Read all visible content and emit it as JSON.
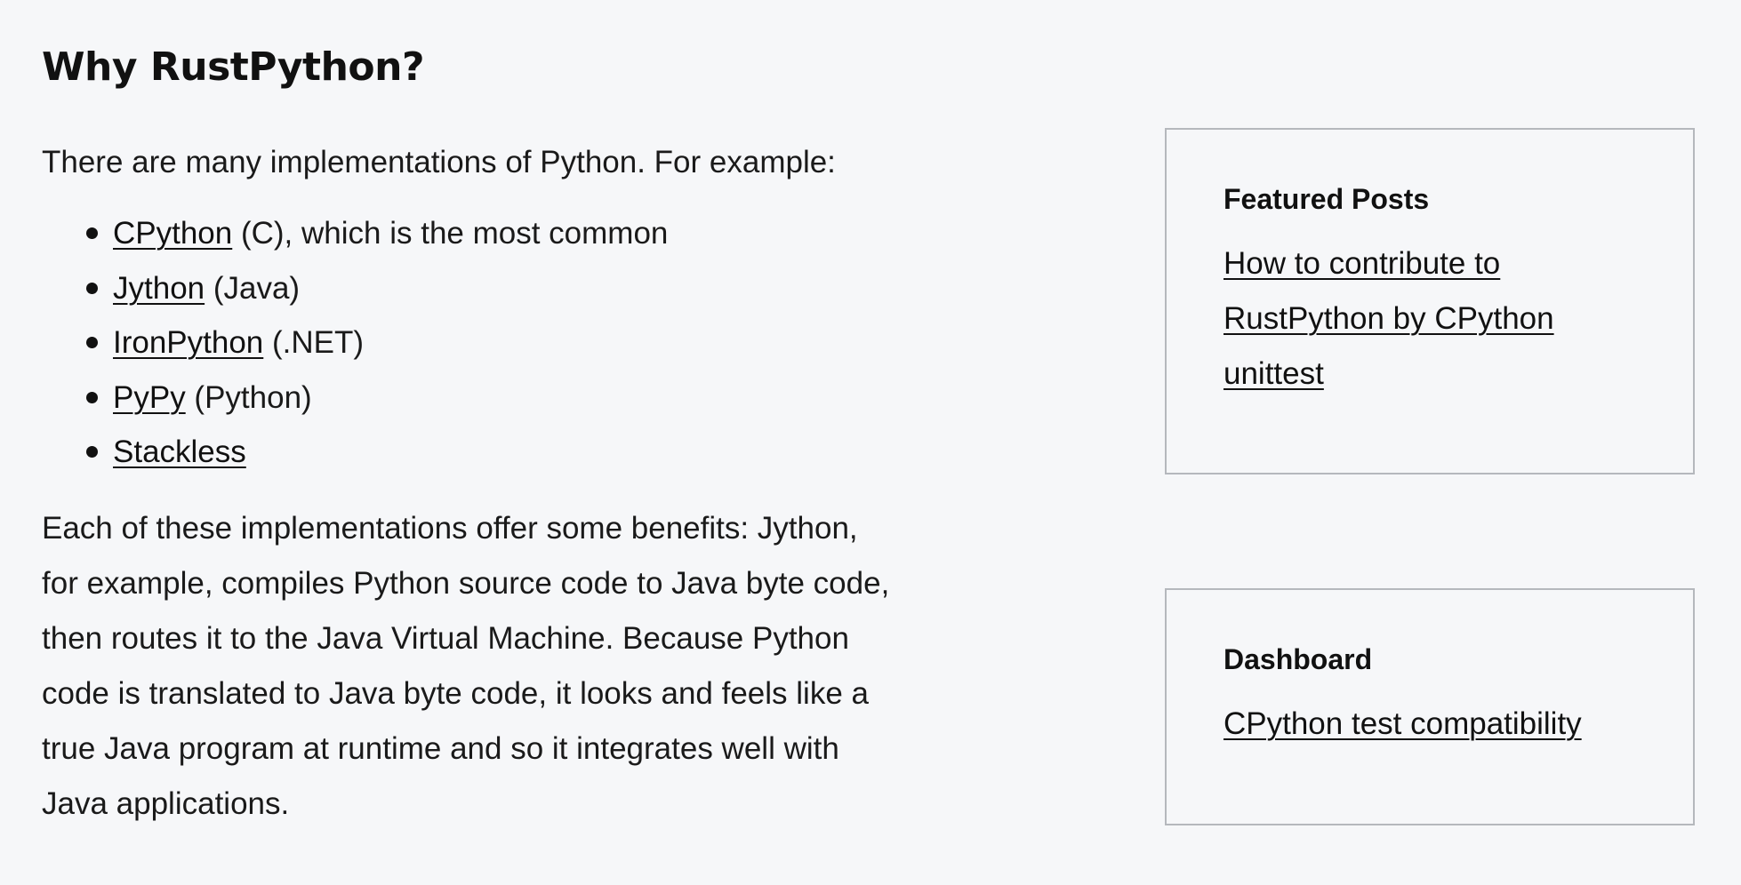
{
  "article": {
    "title": "Why RustPython?",
    "intro": "There are many implementations of Python. For example:",
    "implementations": [
      {
        "link": "CPython",
        "desc": " (C), which is the most common"
      },
      {
        "link": "Jython",
        "desc": " (Java)"
      },
      {
        "link": "IronPython",
        "desc": " (.NET)"
      },
      {
        "link": "PyPy",
        "desc": " (Python)"
      },
      {
        "link": "Stackless",
        "desc": ""
      }
    ],
    "paragraph": "Each of these implementations offer some benefits: Jython, for example, compiles Python source code to Java byte code, then routes it to the Java Virtual Machine. Because Python code is translated to Java byte code, it looks and feels like a true Java program at runtime and so it integrates well with Java applications."
  },
  "sidebar": {
    "featured": {
      "title": "Featured Posts",
      "links": [
        "How to contribute to RustPython by CPython unittest"
      ]
    },
    "dashboard": {
      "title": "Dashboard",
      "links": [
        "CPython test compatibility"
      ]
    }
  }
}
